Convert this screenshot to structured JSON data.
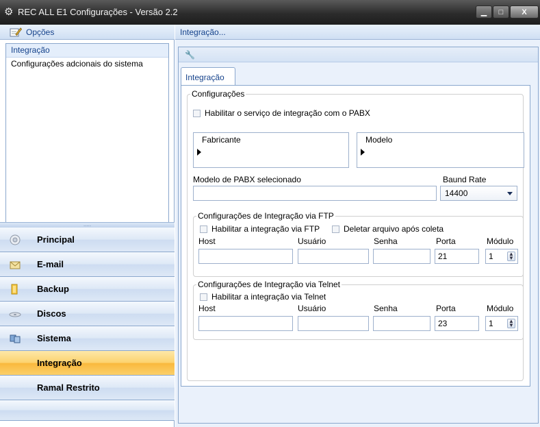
{
  "window": {
    "title": "REC ALL E1 Configurações - Versão 2.2",
    "minimize": "▁",
    "maximize": "□",
    "close": "X"
  },
  "left": {
    "header": "Opções",
    "options": [
      "Integração",
      "Configurações adcionais do sistema"
    ],
    "splitter_grip": ".....",
    "nav": [
      {
        "label": "Principal",
        "icon": "principal-icon"
      },
      {
        "label": "E-mail",
        "icon": "email-icon"
      },
      {
        "label": "Backup",
        "icon": "backup-icon"
      },
      {
        "label": "Discos",
        "icon": "discos-icon"
      },
      {
        "label": "Sistema",
        "icon": "sistema-icon"
      },
      {
        "label": "Integração",
        "icon": "",
        "active": true
      },
      {
        "label": "Ramal Restrito",
        "icon": ""
      }
    ]
  },
  "right": {
    "header": "Integração...",
    "tab": "Integração",
    "configuracoes": {
      "legend": "Configurações",
      "enable_label": "Habilitar o serviço de integração com o PABX",
      "fabricante_header": "Fabricante",
      "modelo_header": "Modelo",
      "modelo_selecionado_label": "Modelo de PABX selecionado",
      "modelo_selecionado_value": "",
      "baud_label": "Baund Rate",
      "baud_value": "14400"
    },
    "ftp": {
      "legend": "Configurações de Integração via FTP",
      "enable_label": "Habilitar a integração via FTP",
      "delete_label": "Deletar arquivo após coleta",
      "host_label": "Host",
      "usuario_label": "Usuário",
      "senha_label": "Senha",
      "porta_label": "Porta",
      "modulo_label": "Módulo",
      "host_value": "",
      "usuario_value": "",
      "senha_value": "",
      "porta_value": "21",
      "modulo_value": "1"
    },
    "telnet": {
      "legend": "Configurações de Integração via Telnet",
      "enable_label": "Habilitar a integração via Telnet",
      "host_label": "Host",
      "usuario_label": "Usuário",
      "senha_label": "Senha",
      "porta_label": "Porta",
      "modulo_label": "Módulo",
      "host_value": "",
      "usuario_value": "",
      "senha_value": "",
      "porta_value": "23",
      "modulo_value": "1"
    }
  },
  "colors": {
    "accent": "#15428b",
    "active_nav": "#fbd06a",
    "border": "#8aa7cd"
  }
}
